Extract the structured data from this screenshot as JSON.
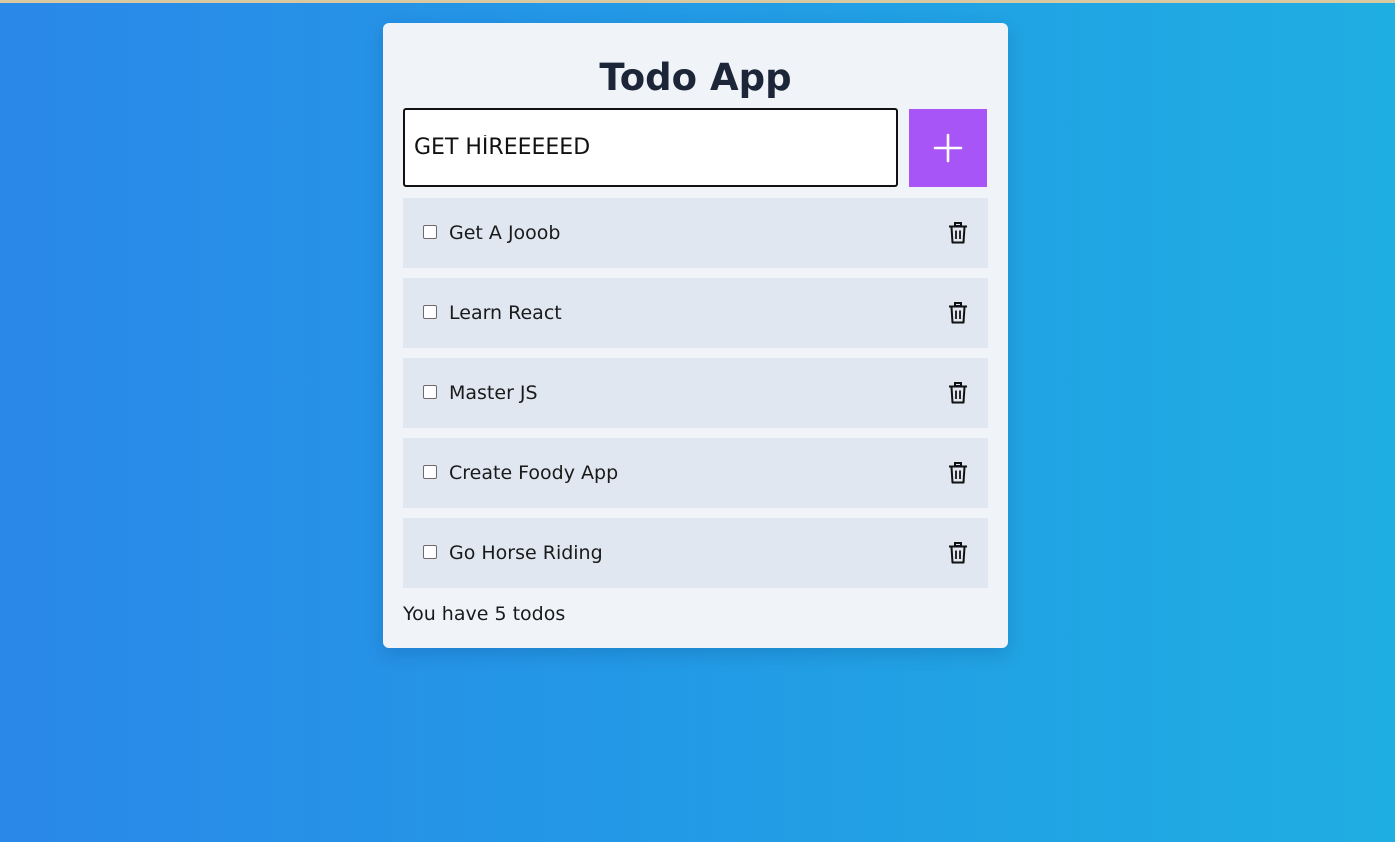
{
  "app": {
    "title": "Todo App"
  },
  "input": {
    "value": "GET HİREEEEED"
  },
  "add_button": {
    "icon": "plus-icon"
  },
  "todos": [
    {
      "label": "Get A Jooob",
      "checked": false
    },
    {
      "label": "Learn React",
      "checked": false
    },
    {
      "label": "Master JS",
      "checked": false
    },
    {
      "label": "Create Foody App",
      "checked": false
    },
    {
      "label": "Go Horse Riding",
      "checked": false
    }
  ],
  "footer": {
    "count_text": "You have 5 todos"
  },
  "colors": {
    "accent": "#a855f7",
    "card_bg": "#f0f4f9",
    "item_bg": "#e0e7f0",
    "title": "#1c2638"
  }
}
